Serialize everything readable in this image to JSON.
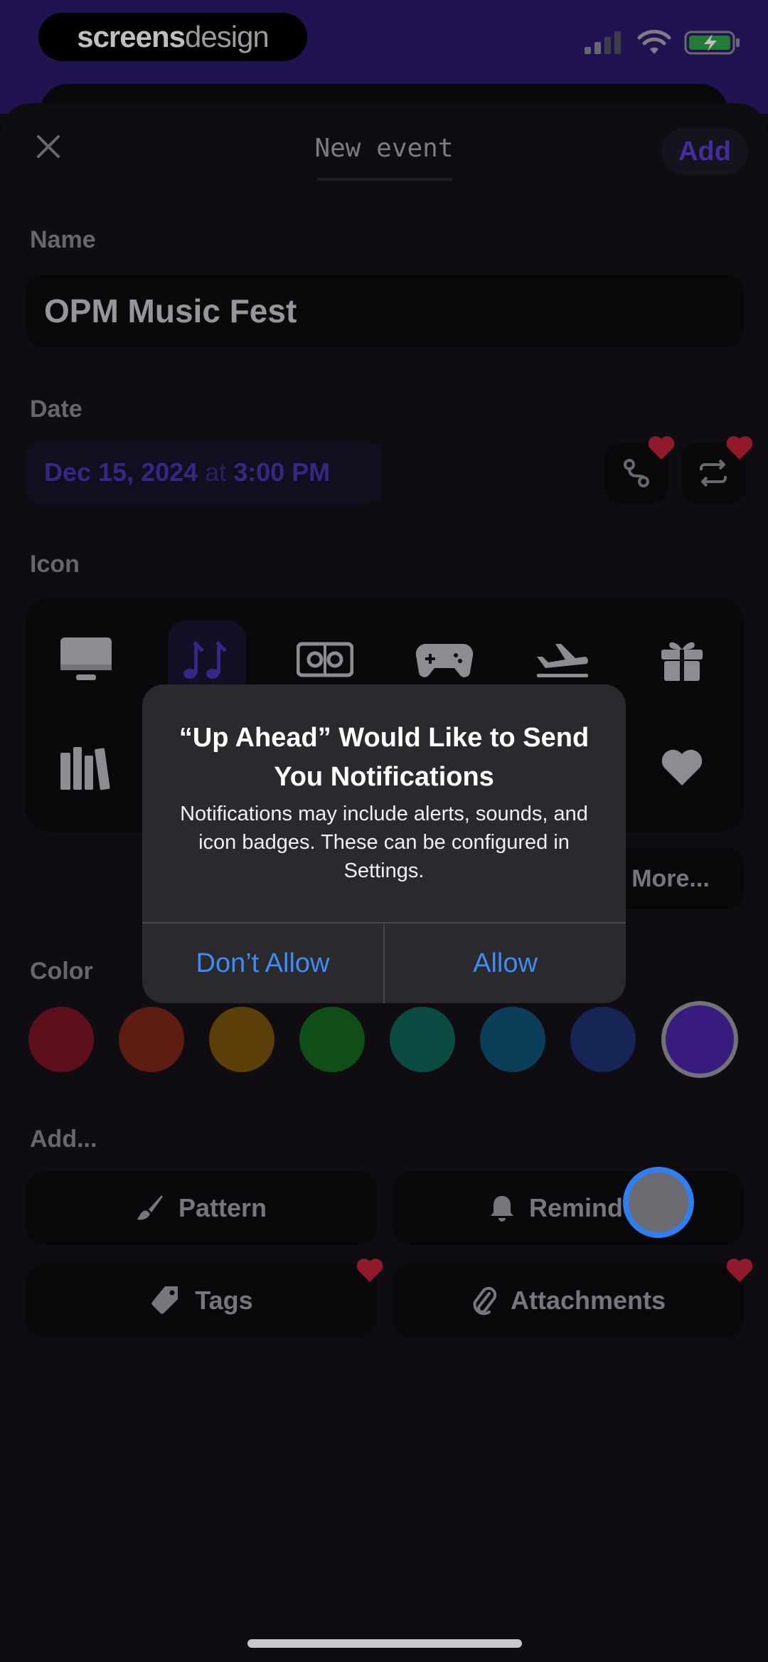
{
  "status_bar": {
    "brand_part1": "screens",
    "brand_part2": "design"
  },
  "nav": {
    "title": "New event",
    "add_label": "Add"
  },
  "form": {
    "name_label": "Name",
    "name_value": "OPM Music Fest",
    "date_label": "Date",
    "date_value": "Dec 15, 2024",
    "date_at": "at",
    "time_value": "3:00 PM",
    "icon_label": "Icon",
    "icons": [
      "monitor-icon",
      "music-notes-icon",
      "ticket-icon",
      "gamepad-icon",
      "airplane-icon",
      "gift-icon",
      "books-icon",
      "heart-icon"
    ],
    "selected_icon": "music-notes-icon",
    "more_label": "More...",
    "color_label": "Color",
    "colors": [
      "#7c1426",
      "#7e2716",
      "#7a560c",
      "#146a1f",
      "#0f6558",
      "#0f5577",
      "#1e3273",
      "#4a25a8"
    ],
    "selected_color": "#4a25a8",
    "add_label": "Add...",
    "add_items": [
      {
        "label": "Pattern",
        "icon": "paintbrush-icon",
        "premium": false
      },
      {
        "label": "Reminder",
        "icon": "bell-icon",
        "premium": false
      },
      {
        "label": "Tags",
        "icon": "tag-icon",
        "premium": true
      },
      {
        "label": "Attachments",
        "icon": "paperclip-icon",
        "premium": true
      }
    ]
  },
  "alert": {
    "title": "“Up Ahead” Would Like to Send You Notifications",
    "message": "Notifications may include alerts, sounds, and icon badges. These can be configured in Settings.",
    "deny_label": "Don’t Allow",
    "allow_label": "Allow"
  },
  "colors": {
    "accent": "#5b3bd0",
    "alert_button": "#3f8cf4",
    "premium_heart": "#c0233a"
  }
}
